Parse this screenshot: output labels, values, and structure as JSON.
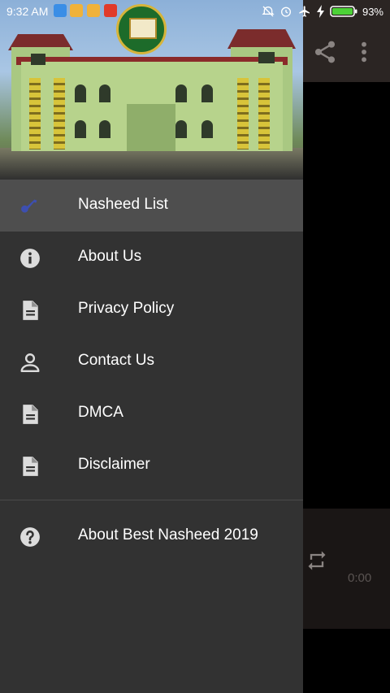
{
  "status_bar": {
    "time": "9:32 AM",
    "battery_percent": "93%",
    "notification_icons": [
      "usb-icon",
      "app-icon",
      "app-icon",
      "game-icon"
    ]
  },
  "background": {
    "player_time": "0:00"
  },
  "drawer": {
    "menu_items": [
      {
        "label": "Nasheed List",
        "icon": "music-note-icon",
        "active": true
      },
      {
        "label": "About Us",
        "icon": "info-icon",
        "active": false
      },
      {
        "label": "Privacy Policy",
        "icon": "document-icon",
        "active": false
      },
      {
        "label": "Contact Us",
        "icon": "person-icon",
        "active": false
      },
      {
        "label": "DMCA",
        "icon": "document-icon",
        "active": false
      },
      {
        "label": "Disclaimer",
        "icon": "document-icon",
        "active": false
      }
    ],
    "about_app": {
      "label": "About Best Nasheed 2019",
      "icon": "help-icon"
    }
  },
  "colors": {
    "drawer_bg": "#323232",
    "active_item_bg": "#4e4e4e",
    "active_icon": "#3d4fb0",
    "icon_gray": "#dcdcdc"
  }
}
